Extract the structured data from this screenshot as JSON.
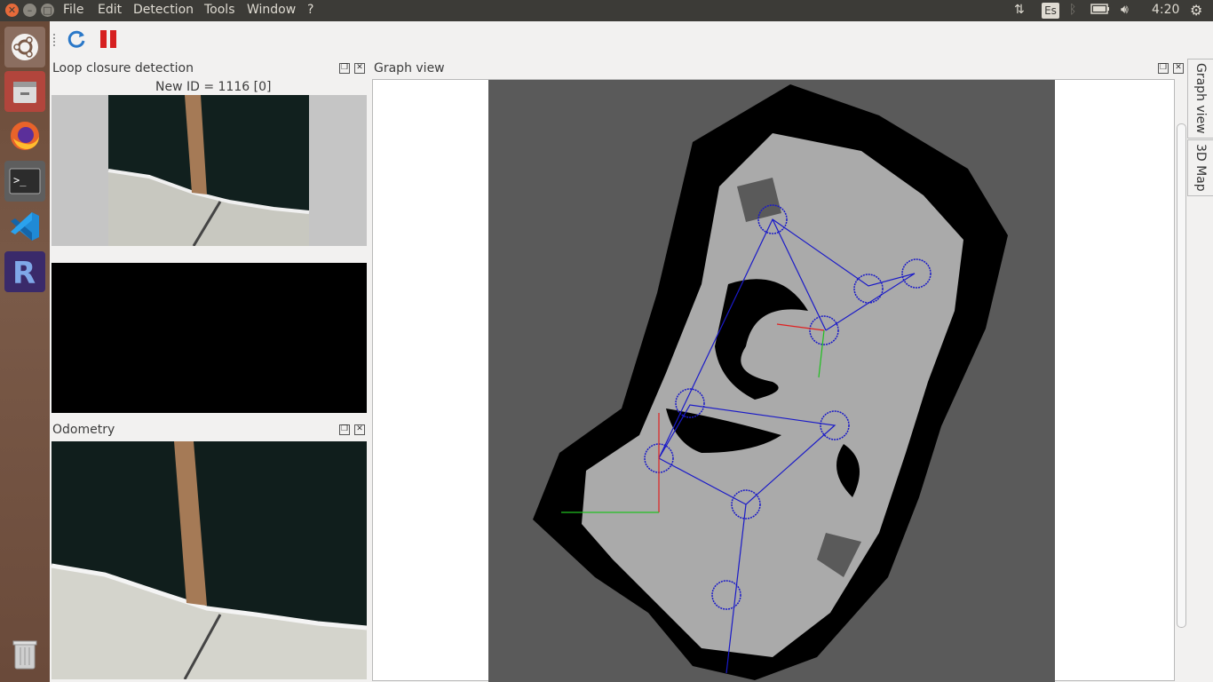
{
  "menubar": {
    "items": [
      "File",
      "Edit",
      "Detection",
      "Tools",
      "Window",
      "?"
    ]
  },
  "tray": {
    "keyboard_layout": "Es",
    "clock": "4:20"
  },
  "launcher": {
    "apps": [
      "ubuntu-logo-icon",
      "file-manager-icon",
      "firefox-icon",
      "terminal-icon",
      "vscode-icon",
      "rstudio-icon",
      "trash-icon"
    ]
  },
  "toolbar": {
    "icons": [
      "refresh-icon",
      "pause-icon"
    ]
  },
  "loop_panel": {
    "title": "Loop closure detection",
    "new_id_label": "New ID = 1116 [0]"
  },
  "odometry_panel": {
    "title": "Odometry"
  },
  "graph_panel": {
    "title": "Graph view"
  },
  "side_tabs": {
    "graph_view": "Graph view",
    "map_3d": "3D Map"
  },
  "colors": {
    "panel_dark": "#3c3b37",
    "map_unknown": "#5a5a5a",
    "map_free": "#aaaaaa",
    "map_obstacle": "#000000",
    "graph_link": "#1a1ac8",
    "close_button": "#e66a3a"
  }
}
